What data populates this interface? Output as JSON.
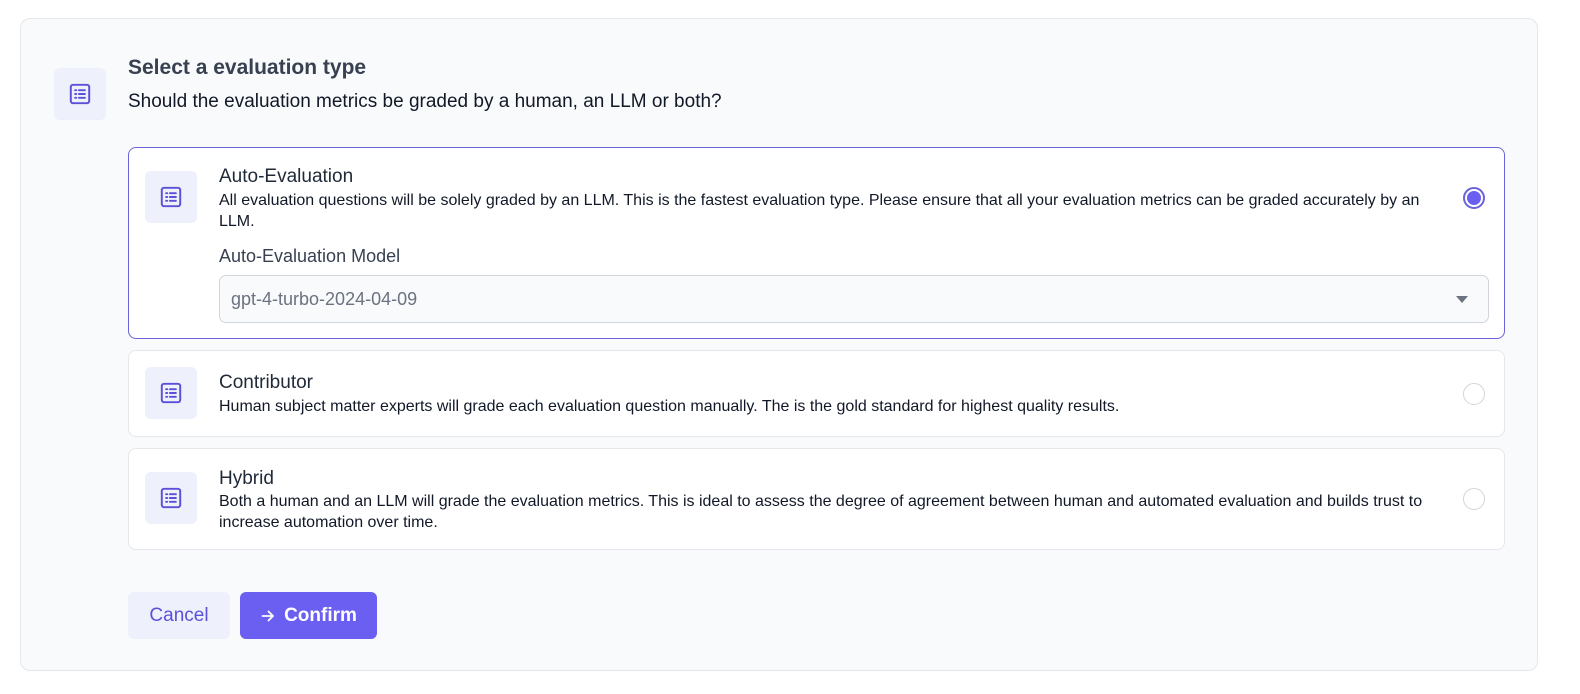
{
  "header": {
    "icon": "list-icon",
    "title": "Select a evaluation type",
    "subtitle": "Should the evaluation metrics be graded by a human, an LLM or both?"
  },
  "options": [
    {
      "icon": "list-icon",
      "title": "Auto-Evaluation",
      "description": "All evaluation questions will be solely graded by an LLM. This is the fastest evaluation type. Please ensure that all your evaluation metrics can be graded accurately by an LLM.",
      "selected": true,
      "model_label": "Auto-Evaluation Model",
      "model_value": "gpt-4-turbo-2024-04-09"
    },
    {
      "icon": "list-icon",
      "title": "Contributor",
      "description": "Human subject matter experts will grade each evaluation question manually. The is the gold standard for highest quality results.",
      "selected": false
    },
    {
      "icon": "list-icon",
      "title": "Hybrid",
      "description": "Both a human and an LLM will grade the evaluation metrics. This is ideal to assess the degree of agreement between human and automated evaluation and builds trust to increase automation over time.",
      "selected": false
    }
  ],
  "buttons": {
    "cancel_label": "Cancel",
    "confirm_label": "Confirm",
    "confirm_icon": "arrow-right-icon"
  },
  "colors": {
    "accent": "#6a5ff0",
    "accent_light": "#eef0fb",
    "selected_border": "#6b63d9"
  }
}
